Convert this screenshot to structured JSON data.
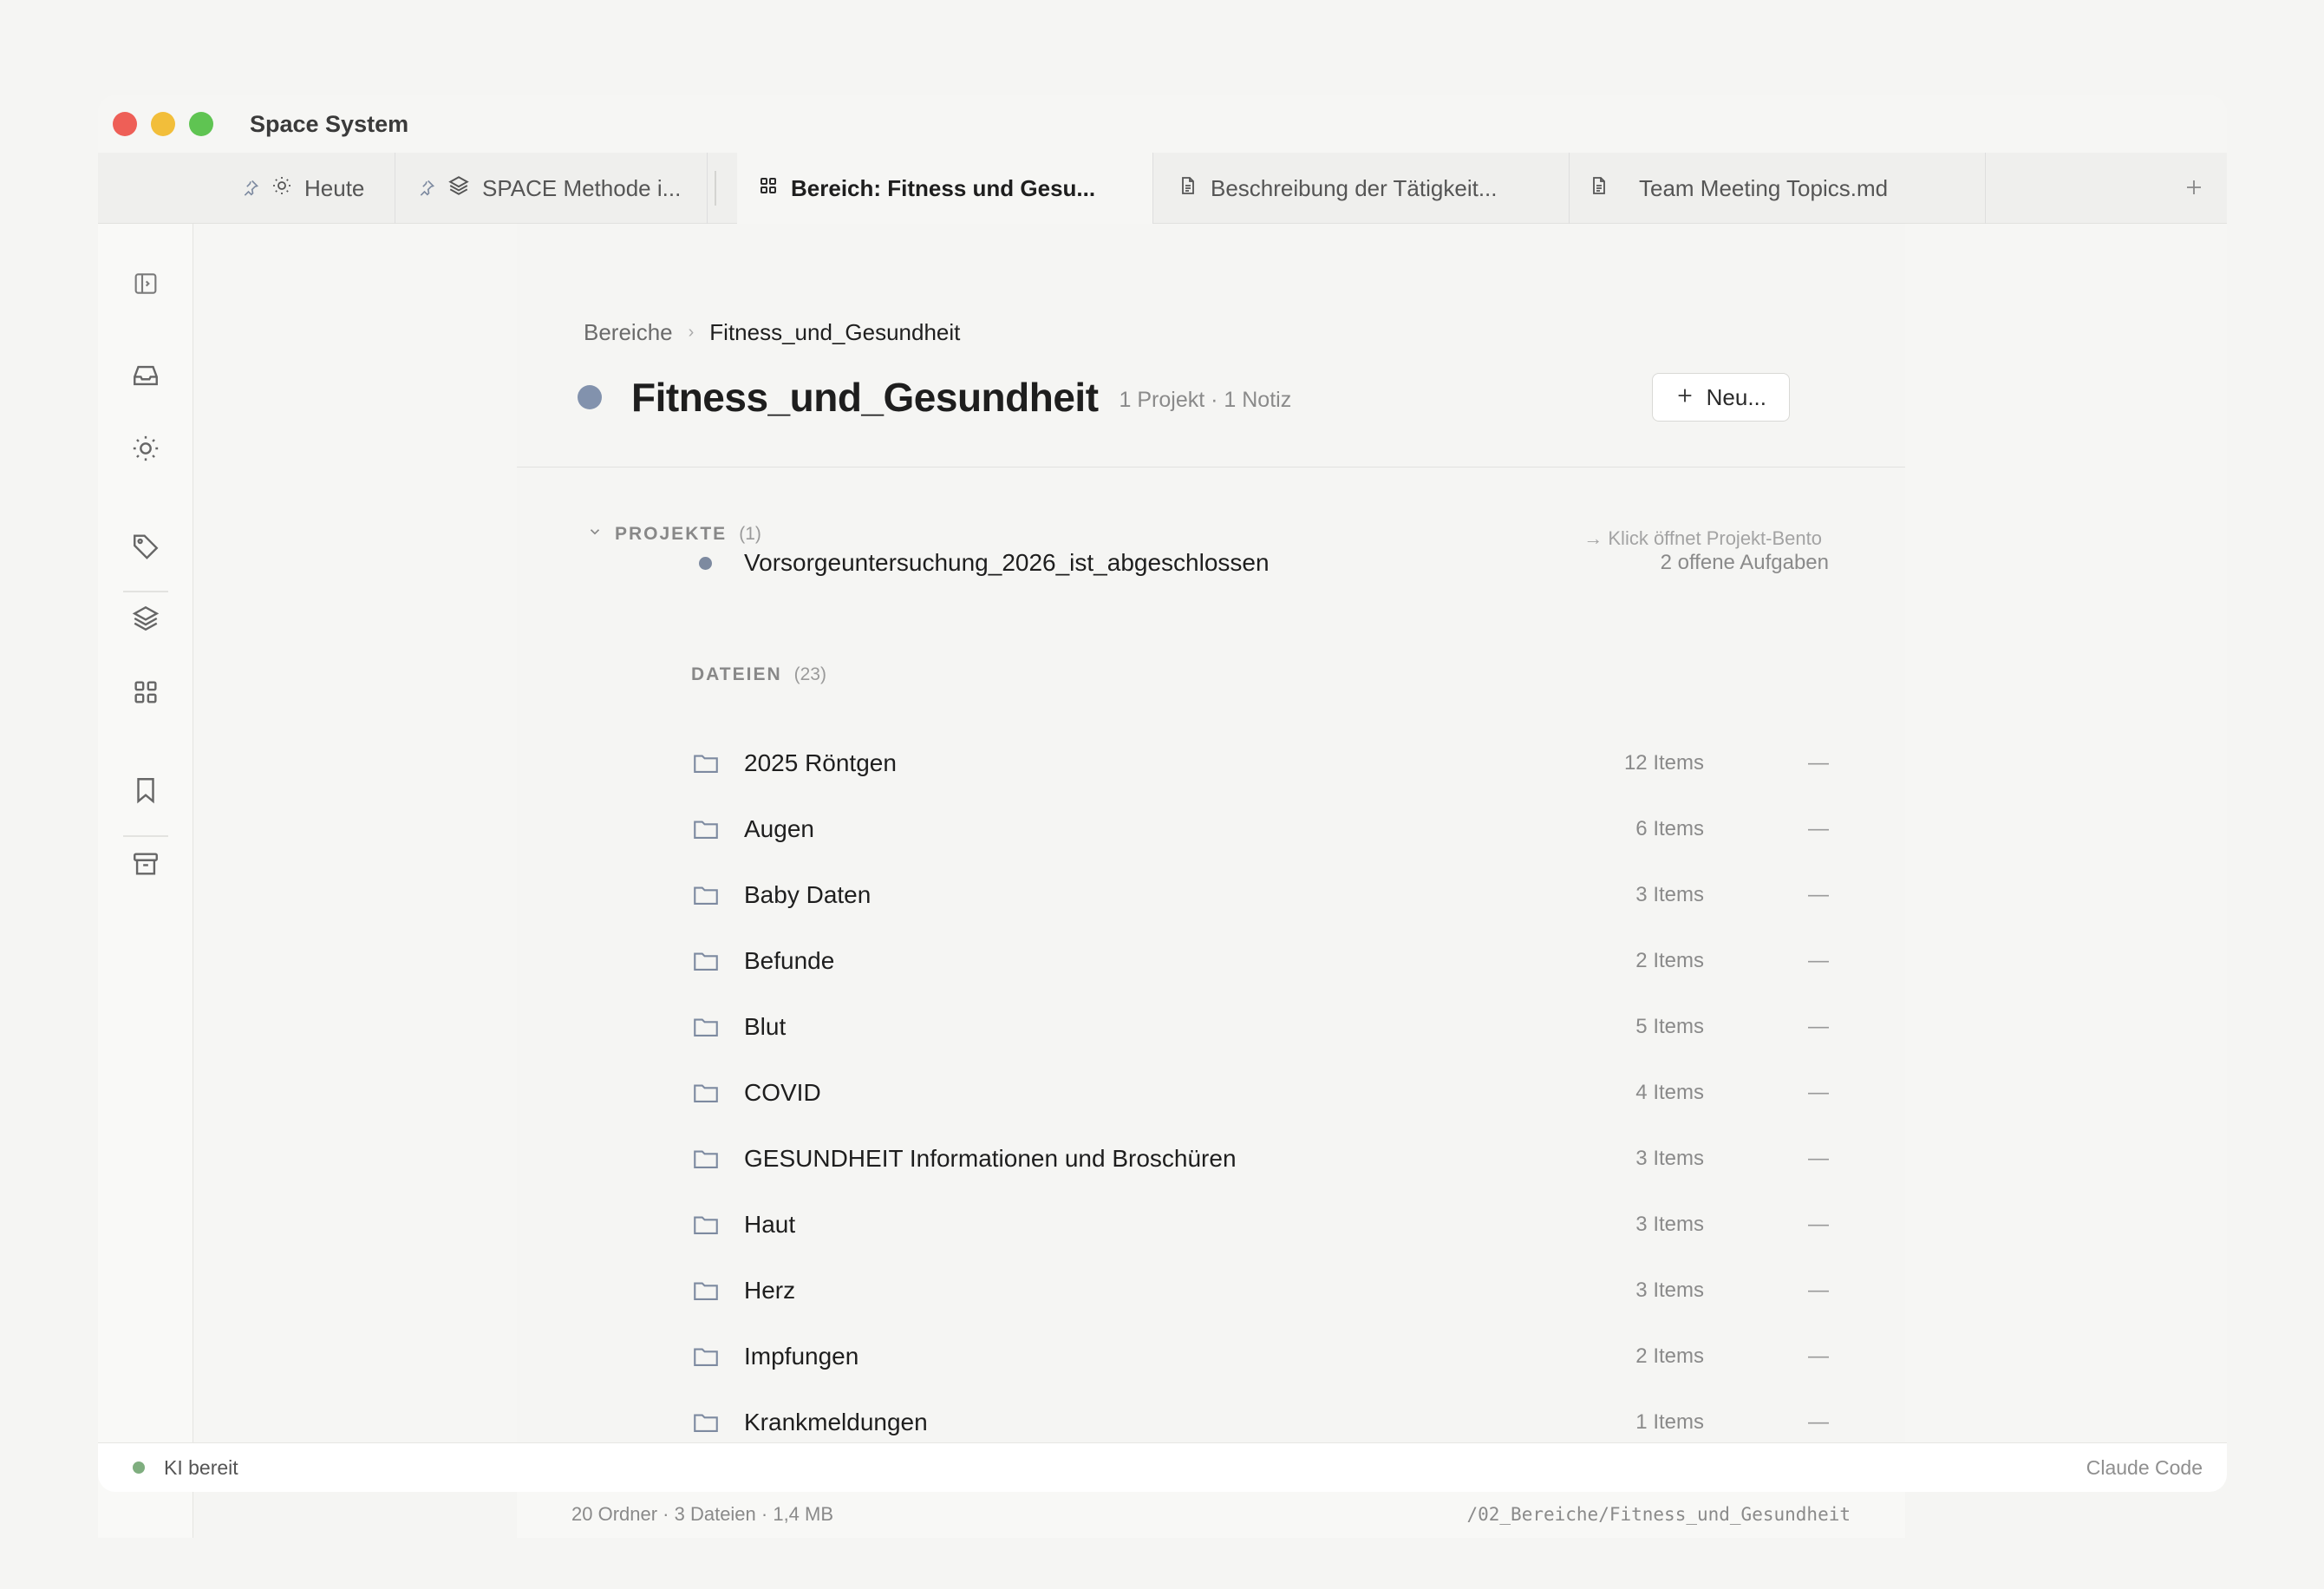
{
  "window": {
    "title": "Space System"
  },
  "tabs": [
    {
      "label": "Heute",
      "icon": "sun-icon",
      "pinned": true
    },
    {
      "label": "SPACE Methode i...",
      "icon": "layers-icon",
      "pinned": true
    },
    {
      "label": "Bereich: Fitness und Gesu...",
      "icon": "grid-icon",
      "active": true
    },
    {
      "label": "Beschreibung der Tätigkeit...",
      "icon": "document-icon"
    },
    {
      "label": "Team Meeting Topics.md",
      "icon": "document-icon"
    }
  ],
  "rail": {
    "items": [
      "sidebar-toggle-icon",
      "inbox-icon",
      "sun-icon",
      "tag-icon",
      "layers-icon",
      "grid-icon",
      "bookmark-icon",
      "archive-icon"
    ]
  },
  "breadcrumb": {
    "root": "Bereiche",
    "separator": "›",
    "current": "Fitness_und_Gesundheit"
  },
  "header": {
    "title": "Fitness_und_Gesundheit",
    "meta": "1 Projekt · 1 Notiz",
    "new_button": "Neu...",
    "dot_color": "#8292ad"
  },
  "projects": {
    "heading": "PROJEKTE",
    "count": "(1)",
    "hint": "→ Klick öffnet Projekt-Bento",
    "items": [
      {
        "name": "Vorsorgeuntersuchung_2026_ist_abgeschlossen",
        "tasks": "2 offene Aufgaben"
      }
    ]
  },
  "files": {
    "heading": "DATEIEN",
    "count": "(23)",
    "items": [
      {
        "name": "2025 Röntgen",
        "items": "12 Items",
        "dash": "—"
      },
      {
        "name": "Augen",
        "items": "6 Items",
        "dash": "—"
      },
      {
        "name": "Baby Daten",
        "items": "3 Items",
        "dash": "—"
      },
      {
        "name": "Befunde",
        "items": "2 Items",
        "dash": "—"
      },
      {
        "name": "Blut",
        "items": "5 Items",
        "dash": "—"
      },
      {
        "name": "COVID",
        "items": "4 Items",
        "dash": "—"
      },
      {
        "name": "GESUNDHEIT Informationen und Broschüren",
        "items": "3 Items",
        "dash": "—"
      },
      {
        "name": "Haut",
        "items": "3 Items",
        "dash": "—"
      },
      {
        "name": "Herz",
        "items": "3 Items",
        "dash": "—"
      },
      {
        "name": "Impfungen",
        "items": "2 Items",
        "dash": "—"
      },
      {
        "name": "Krankmeldungen",
        "items": "1 Items",
        "dash": "—"
      }
    ]
  },
  "footer": {
    "summary": "20 Ordner · 3 Dateien · 1,4 MB",
    "path": "/02_Bereiche/Fitness_und_Gesundheit"
  },
  "statusbar": {
    "status": "KI bereit",
    "right": "Claude Code"
  }
}
